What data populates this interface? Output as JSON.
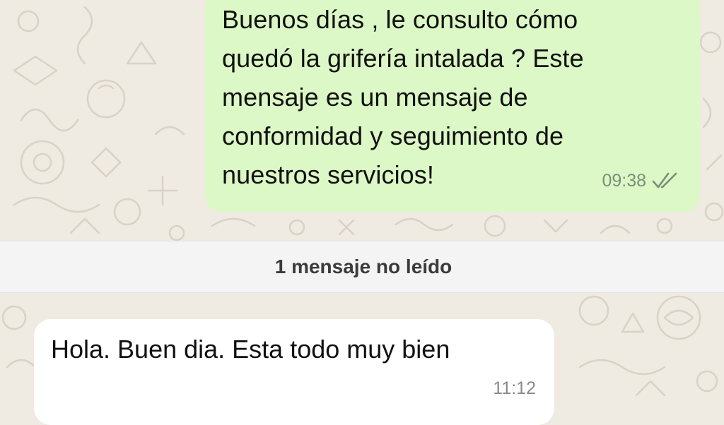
{
  "chat": {
    "outgoing": {
      "lines": [
        "Buenos días  , le consulto cómo",
        "quedó la grifería intalada ? Este",
        "mensaje es un mensaje de",
        "conformidad y seguimiento de",
        "nuestros servicios!"
      ],
      "time": "09:38",
      "status_icon": "double-check-icon"
    },
    "unread_divider": "1 mensaje no leído",
    "incoming": {
      "text": "Hola. Buen dia. Esta todo muy bien",
      "time": "11:12"
    }
  },
  "colors": {
    "wallpaper": "#efeae2",
    "outgoing_bubble": "#dcf8c6",
    "incoming_bubble": "#ffffff",
    "unread_bar": "#f4f4f4",
    "time_outgoing": "#7d8d78",
    "time_incoming": "#8a8a8a",
    "check": "#7d8d78"
  }
}
